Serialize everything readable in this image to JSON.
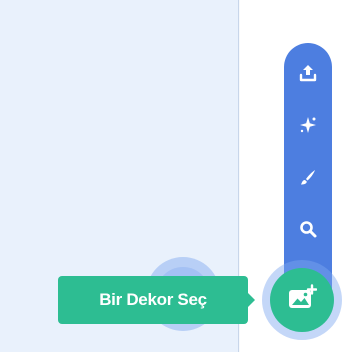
{
  "colors": {
    "left_pane_bg": "#e9f1fc",
    "menu_strip": "#4d7ee0",
    "accent_green": "#2dbd92",
    "halo_blue": "#7da6f0",
    "icon_white": "#ffffff"
  },
  "backdrop_menu": {
    "items": [
      {
        "name": "upload-backdrop",
        "icon": "upload-icon"
      },
      {
        "name": "surprise-backdrop",
        "icon": "sparkle-icon"
      },
      {
        "name": "paint-backdrop",
        "icon": "paintbrush-icon"
      },
      {
        "name": "search-backdrop",
        "icon": "search-icon"
      }
    ]
  },
  "choose_backdrop": {
    "tooltip": "Bir Dekor Seç",
    "icon": "backdrop-image-add-icon"
  }
}
